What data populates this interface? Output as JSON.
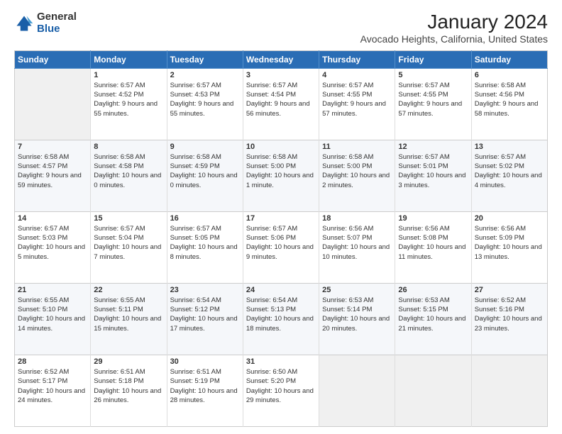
{
  "logo": {
    "general": "General",
    "blue": "Blue"
  },
  "title": "January 2024",
  "subtitle": "Avocado Heights, California, United States",
  "calendar": {
    "headers": [
      "Sunday",
      "Monday",
      "Tuesday",
      "Wednesday",
      "Thursday",
      "Friday",
      "Saturday"
    ],
    "weeks": [
      [
        {
          "day": "",
          "sunrise": "",
          "sunset": "",
          "daylight": "",
          "empty": true
        },
        {
          "day": "1",
          "sunrise": "Sunrise: 6:57 AM",
          "sunset": "Sunset: 4:52 PM",
          "daylight": "Daylight: 9 hours and 55 minutes."
        },
        {
          "day": "2",
          "sunrise": "Sunrise: 6:57 AM",
          "sunset": "Sunset: 4:53 PM",
          "daylight": "Daylight: 9 hours and 55 minutes."
        },
        {
          "day": "3",
          "sunrise": "Sunrise: 6:57 AM",
          "sunset": "Sunset: 4:54 PM",
          "daylight": "Daylight: 9 hours and 56 minutes."
        },
        {
          "day": "4",
          "sunrise": "Sunrise: 6:57 AM",
          "sunset": "Sunset: 4:55 PM",
          "daylight": "Daylight: 9 hours and 57 minutes."
        },
        {
          "day": "5",
          "sunrise": "Sunrise: 6:57 AM",
          "sunset": "Sunset: 4:55 PM",
          "daylight": "Daylight: 9 hours and 57 minutes."
        },
        {
          "day": "6",
          "sunrise": "Sunrise: 6:58 AM",
          "sunset": "Sunset: 4:56 PM",
          "daylight": "Daylight: 9 hours and 58 minutes."
        }
      ],
      [
        {
          "day": "7",
          "sunrise": "Sunrise: 6:58 AM",
          "sunset": "Sunset: 4:57 PM",
          "daylight": "Daylight: 9 hours and 59 minutes."
        },
        {
          "day": "8",
          "sunrise": "Sunrise: 6:58 AM",
          "sunset": "Sunset: 4:58 PM",
          "daylight": "Daylight: 10 hours and 0 minutes."
        },
        {
          "day": "9",
          "sunrise": "Sunrise: 6:58 AM",
          "sunset": "Sunset: 4:59 PM",
          "daylight": "Daylight: 10 hours and 0 minutes."
        },
        {
          "day": "10",
          "sunrise": "Sunrise: 6:58 AM",
          "sunset": "Sunset: 5:00 PM",
          "daylight": "Daylight: 10 hours and 1 minute."
        },
        {
          "day": "11",
          "sunrise": "Sunrise: 6:58 AM",
          "sunset": "Sunset: 5:00 PM",
          "daylight": "Daylight: 10 hours and 2 minutes."
        },
        {
          "day": "12",
          "sunrise": "Sunrise: 6:57 AM",
          "sunset": "Sunset: 5:01 PM",
          "daylight": "Daylight: 10 hours and 3 minutes."
        },
        {
          "day": "13",
          "sunrise": "Sunrise: 6:57 AM",
          "sunset": "Sunset: 5:02 PM",
          "daylight": "Daylight: 10 hours and 4 minutes."
        }
      ],
      [
        {
          "day": "14",
          "sunrise": "Sunrise: 6:57 AM",
          "sunset": "Sunset: 5:03 PM",
          "daylight": "Daylight: 10 hours and 5 minutes."
        },
        {
          "day": "15",
          "sunrise": "Sunrise: 6:57 AM",
          "sunset": "Sunset: 5:04 PM",
          "daylight": "Daylight: 10 hours and 7 minutes."
        },
        {
          "day": "16",
          "sunrise": "Sunrise: 6:57 AM",
          "sunset": "Sunset: 5:05 PM",
          "daylight": "Daylight: 10 hours and 8 minutes."
        },
        {
          "day": "17",
          "sunrise": "Sunrise: 6:57 AM",
          "sunset": "Sunset: 5:06 PM",
          "daylight": "Daylight: 10 hours and 9 minutes."
        },
        {
          "day": "18",
          "sunrise": "Sunrise: 6:56 AM",
          "sunset": "Sunset: 5:07 PM",
          "daylight": "Daylight: 10 hours and 10 minutes."
        },
        {
          "day": "19",
          "sunrise": "Sunrise: 6:56 AM",
          "sunset": "Sunset: 5:08 PM",
          "daylight": "Daylight: 10 hours and 11 minutes."
        },
        {
          "day": "20",
          "sunrise": "Sunrise: 6:56 AM",
          "sunset": "Sunset: 5:09 PM",
          "daylight": "Daylight: 10 hours and 13 minutes."
        }
      ],
      [
        {
          "day": "21",
          "sunrise": "Sunrise: 6:55 AM",
          "sunset": "Sunset: 5:10 PM",
          "daylight": "Daylight: 10 hours and 14 minutes."
        },
        {
          "day": "22",
          "sunrise": "Sunrise: 6:55 AM",
          "sunset": "Sunset: 5:11 PM",
          "daylight": "Daylight: 10 hours and 15 minutes."
        },
        {
          "day": "23",
          "sunrise": "Sunrise: 6:54 AM",
          "sunset": "Sunset: 5:12 PM",
          "daylight": "Daylight: 10 hours and 17 minutes."
        },
        {
          "day": "24",
          "sunrise": "Sunrise: 6:54 AM",
          "sunset": "Sunset: 5:13 PM",
          "daylight": "Daylight: 10 hours and 18 minutes."
        },
        {
          "day": "25",
          "sunrise": "Sunrise: 6:53 AM",
          "sunset": "Sunset: 5:14 PM",
          "daylight": "Daylight: 10 hours and 20 minutes."
        },
        {
          "day": "26",
          "sunrise": "Sunrise: 6:53 AM",
          "sunset": "Sunset: 5:15 PM",
          "daylight": "Daylight: 10 hours and 21 minutes."
        },
        {
          "day": "27",
          "sunrise": "Sunrise: 6:52 AM",
          "sunset": "Sunset: 5:16 PM",
          "daylight": "Daylight: 10 hours and 23 minutes."
        }
      ],
      [
        {
          "day": "28",
          "sunrise": "Sunrise: 6:52 AM",
          "sunset": "Sunset: 5:17 PM",
          "daylight": "Daylight: 10 hours and 24 minutes."
        },
        {
          "day": "29",
          "sunrise": "Sunrise: 6:51 AM",
          "sunset": "Sunset: 5:18 PM",
          "daylight": "Daylight: 10 hours and 26 minutes."
        },
        {
          "day": "30",
          "sunrise": "Sunrise: 6:51 AM",
          "sunset": "Sunset: 5:19 PM",
          "daylight": "Daylight: 10 hours and 28 minutes."
        },
        {
          "day": "31",
          "sunrise": "Sunrise: 6:50 AM",
          "sunset": "Sunset: 5:20 PM",
          "daylight": "Daylight: 10 hours and 29 minutes."
        },
        {
          "day": "",
          "sunrise": "",
          "sunset": "",
          "daylight": "",
          "empty": true
        },
        {
          "day": "",
          "sunrise": "",
          "sunset": "",
          "daylight": "",
          "empty": true
        },
        {
          "day": "",
          "sunrise": "",
          "sunset": "",
          "daylight": "",
          "empty": true
        }
      ]
    ]
  }
}
